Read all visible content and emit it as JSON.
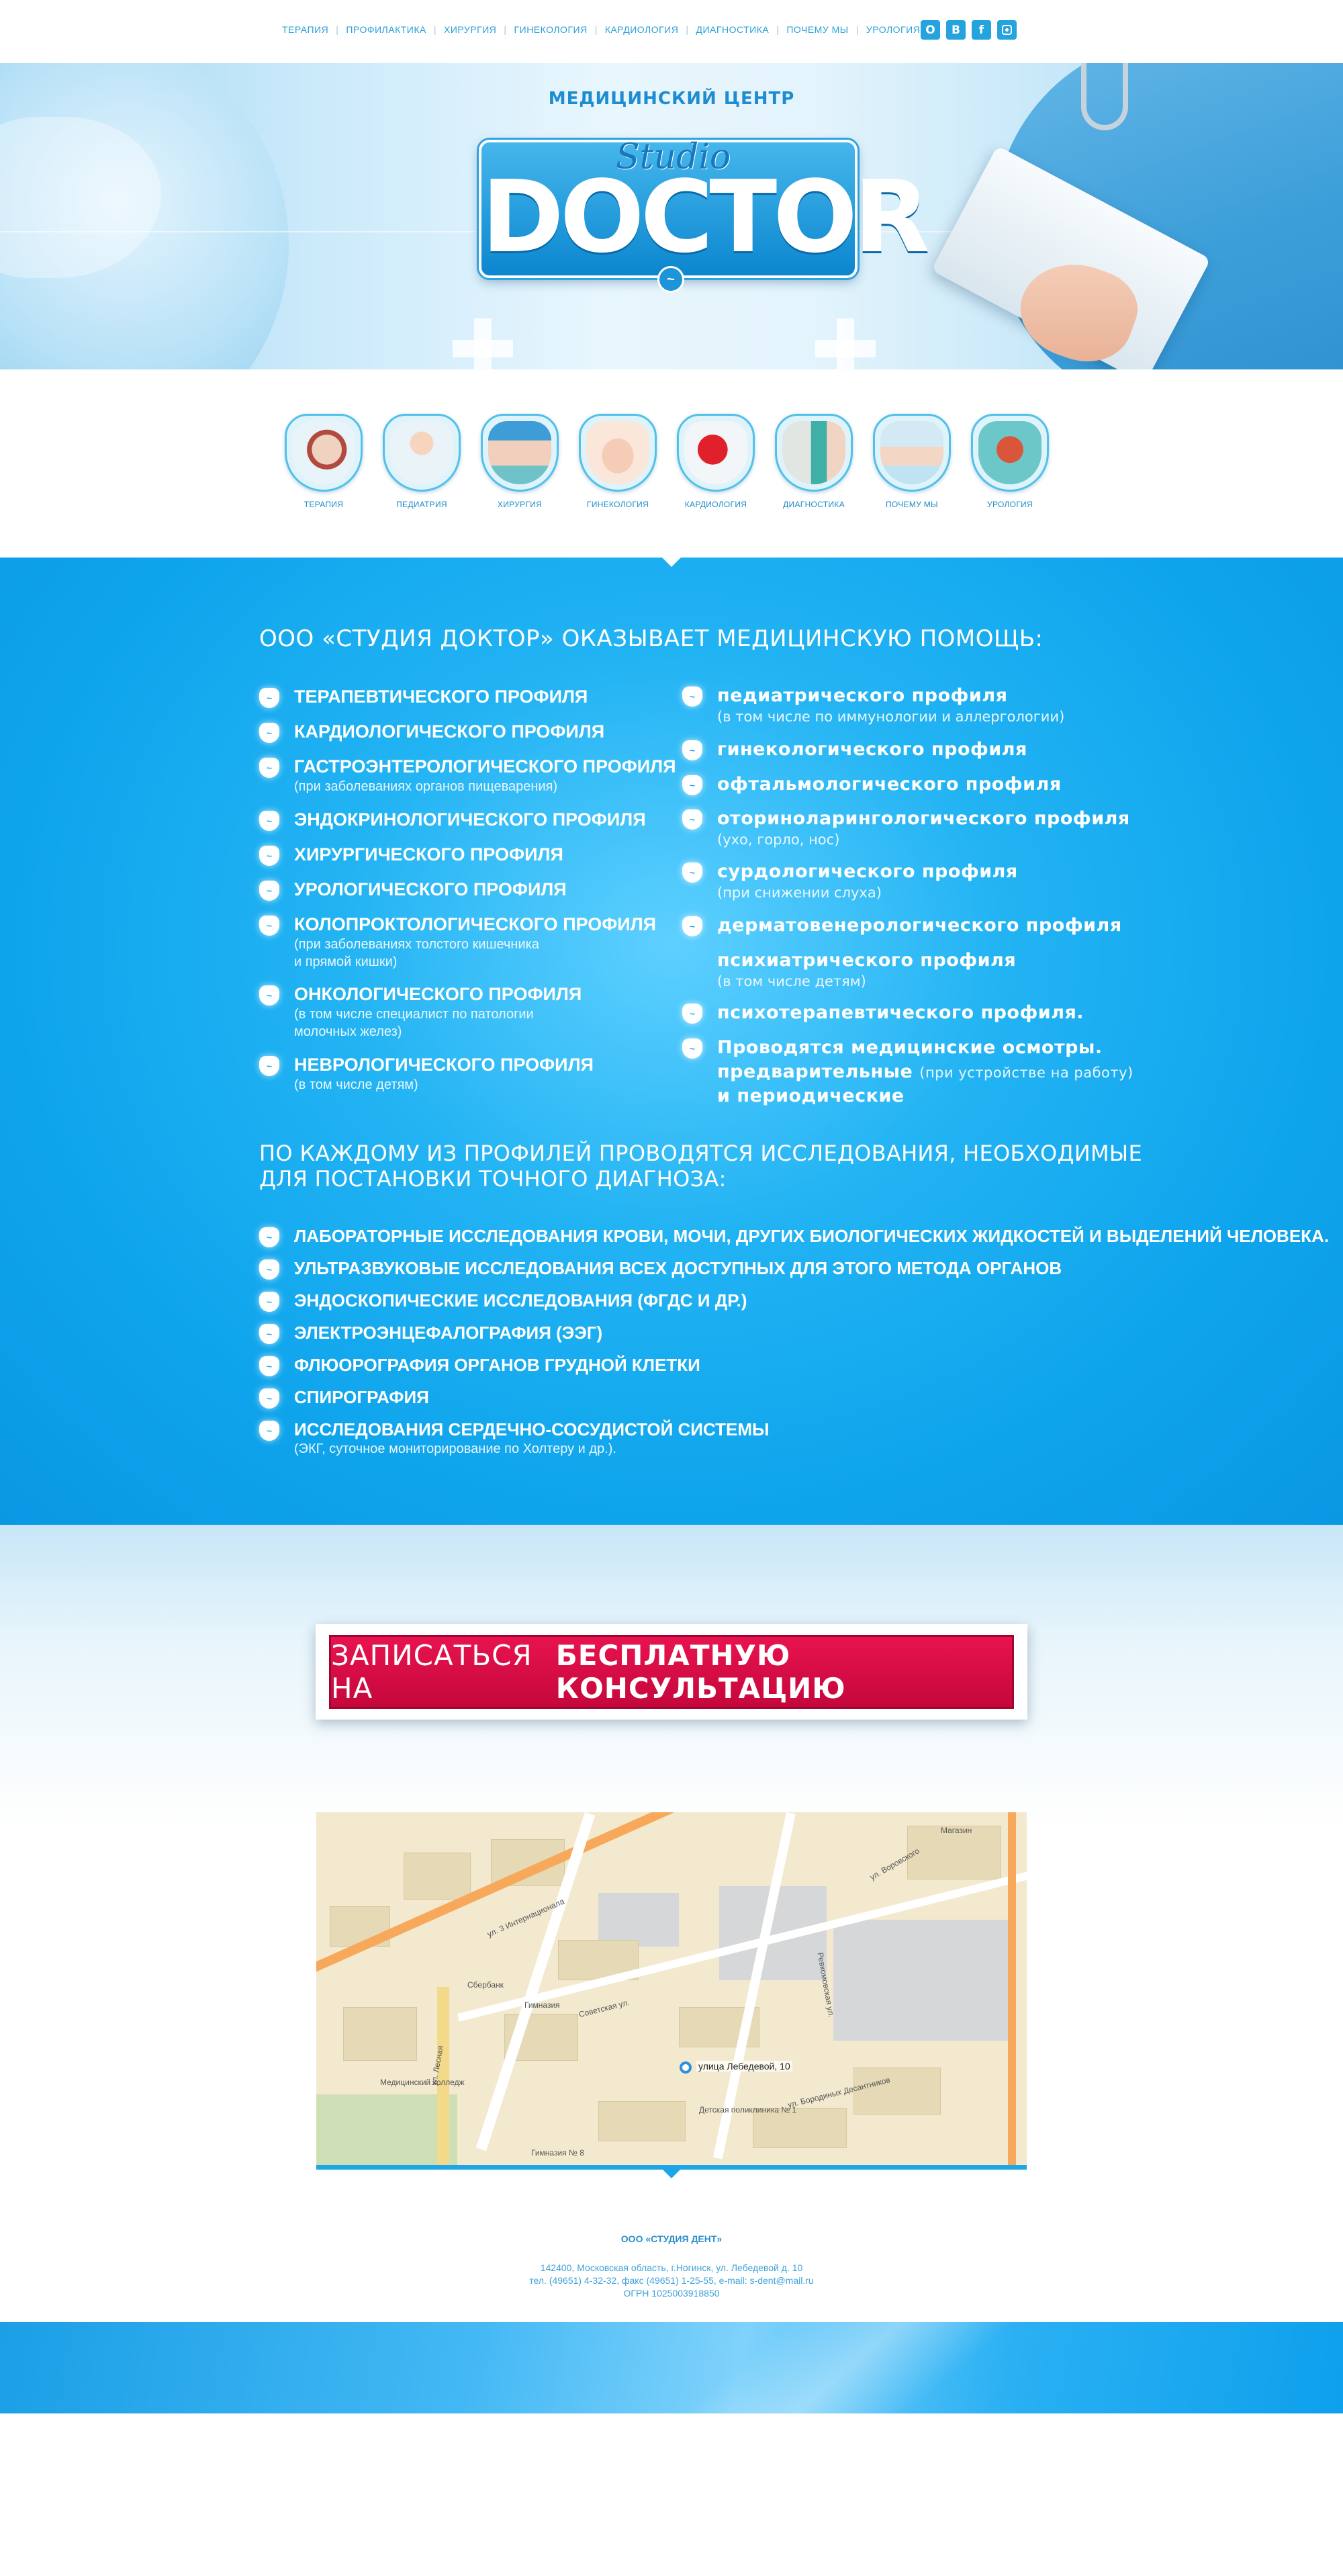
{
  "nav": {
    "links": [
      "ТЕРАПИЯ",
      "ПРОФИЛАКТИКА",
      "ХИРУРГИЯ",
      "ГИНЕКОЛОГИЯ",
      "КАРДИОЛОГИЯ",
      "ДИАГНОСТИКА",
      "ПОЧЕМУ МЫ",
      "УРОЛОГИЯ"
    ],
    "social": [
      "ok-icon",
      "vk-icon",
      "facebook-icon",
      "instagram-icon"
    ]
  },
  "hero": {
    "subtitle": "МЕДИЦИНСКИЙ ЦЕНТР",
    "logo_script": "Studio",
    "logo_main": "DOCTOR"
  },
  "categories": [
    {
      "label": "ТЕРАПИЯ",
      "icon": "stethoscope-icon"
    },
    {
      "label": "ПЕДИАТРИЯ",
      "icon": "baby-icon"
    },
    {
      "label": "ХИРУРГИЯ",
      "icon": "surgeon-icon"
    },
    {
      "label": "ГИНЕКОЛОГИЯ",
      "icon": "heart-hands-icon"
    },
    {
      "label": "КАРДИОЛОГИЯ",
      "icon": "heart-icon"
    },
    {
      "label": "ДИАГНОСТИКА",
      "icon": "lab-icon"
    },
    {
      "label": "ПОЧЕМУ МЫ",
      "icon": "doctor-icon"
    },
    {
      "label": "УРОЛОГИЯ",
      "icon": "kidney-icon"
    }
  ],
  "services": {
    "intro": "ООО «СТУДИЯ ДОКТОР» ОКАЗЫВАЕТ МЕДИЦИНСКУЮ ПОМОЩЬ:",
    "col1": [
      {
        "title": "ТЕРАПЕВТИЧЕСКОГО ПРОФИЛЯ",
        "note": ""
      },
      {
        "title": "КАРДИОЛОГИЧЕСКОГО ПРОФИЛЯ",
        "note": ""
      },
      {
        "title": "ГАСТРОЭНТЕРОЛОГИЧЕСКОГО ПРОФИЛЯ",
        "note": "(при заболеваниях органов пищеварения)"
      },
      {
        "title": "ЭНДОКРИНОЛОГИЧЕСКОГО ПРОФИЛЯ",
        "note": ""
      },
      {
        "title": "ХИРУРГИЧЕСКОГО ПРОФИЛЯ",
        "note": ""
      },
      {
        "title": "УРОЛОГИЧЕСКОГО ПРОФИЛЯ",
        "note": ""
      },
      {
        "title": "КОЛОПРОКТОЛОГИЧЕСКОГО ПРОФИЛЯ",
        "note": "(при заболеваниях толстого кишечника",
        "note2": "и прямой кишки)"
      },
      {
        "title": "ОНКОЛОГИЧЕСКОГО ПРОФИЛЯ",
        "note": "(в том числе специалист по патологии",
        "note2": "молочных желез)"
      },
      {
        "title": "НЕВРОЛОГИЧЕСКОГО ПРОФИЛЯ",
        "note": "(в том числе детям)"
      }
    ],
    "col2": [
      {
        "title": "педиатрического профиля",
        "note": "(в том числе по иммунологии и аллергологии)"
      },
      {
        "title": "гинекологического профиля",
        "note": ""
      },
      {
        "title": "офтальмологического профиля",
        "note": ""
      },
      {
        "title": "оториноларингологического профиля",
        "note": "(ухо, горло, нос)"
      },
      {
        "title": "сурдологического профиля",
        "note": "(при снижении слуха)"
      },
      {
        "title": "дерматовенерологического профиля",
        "note": ""
      },
      {
        "title": "психиатрического профиля",
        "note": "(в том числе детям)"
      },
      {
        "title": "психотерапевтического профиля.",
        "note": ""
      },
      {
        "title": "Проводятся медицинские осмотры.",
        "line2": "предварительные",
        "line2note": "(при устройстве на работу)",
        "line3": "и периодические"
      }
    ]
  },
  "research": {
    "title_line1": "ПО КАЖДОМУ ИЗ ПРОФИЛЕЙ ПРОВОДЯТСЯ ИССЛЕДОВАНИЯ, НЕОБХОДИМЫЕ",
    "title_line2": "ДЛЯ ПОСТАНОВКИ ТОЧНОГО ДИАГНОЗА:",
    "items": [
      {
        "title": "ЛАБОРАТОРНЫЕ ИССЛЕДОВАНИЯ КРОВИ, МОЧИ, ДРУГИХ БИОЛОГИЧЕСКИХ ЖИДКОСТЕЙ И ВЫДЕЛЕНИЙ ЧЕЛОВЕКА.",
        "note": ""
      },
      {
        "title": "УЛЬТРАЗВУКОВЫЕ ИССЛЕДОВАНИЯ ВСЕХ ДОСТУПНЫХ ДЛЯ ЭТОГО МЕТОДА ОРГАНОВ",
        "note": ""
      },
      {
        "title": "ЭНДОСКОПИЧЕСКИЕ ИССЛЕДОВАНИЯ (ФГДС И ДР.)",
        "note": ""
      },
      {
        "title": "ЭЛЕКТРОЭНЦЕФАЛОГРАФИЯ (ЭЭГ)",
        "note": ""
      },
      {
        "title": "ФЛЮОРОГРАФИЯ ОРГАНОВ ГРУДНОЙ КЛЕТКИ",
        "note": ""
      },
      {
        "title": "СПИРОГРАФИЯ",
        "note": ""
      },
      {
        "title": "ИССЛЕДОВАНИЯ СЕРДЕЧНО-СОСУДИСТОЙ СИСТЕМЫ",
        "note": "(ЭКГ, суточное мониторирование по Холтеру и др.)."
      }
    ]
  },
  "cta": {
    "light": "ЗАПИСАТЬСЯ НА",
    "bold": "БЕСПЛАТНУЮ КОНСУЛЬТАЦИЮ"
  },
  "map": {
    "pin_label": "улица Лебедевой, 10",
    "street1": "ул. 3 Интернационала",
    "street2": "ул. Лесная",
    "street3": "Советская ул.",
    "street4": "ул. Воровского",
    "street5": "ул. Бородиных Десантников",
    "street6": "Ревкомовская ул.",
    "place1": "Детская поликлиника № 1",
    "place2": "Гимназия № 8",
    "place3": "Гимназия",
    "place4": "Медицинский колледж",
    "place5": "Сбербанк",
    "place6": "Магазин"
  },
  "footer": {
    "company": "ООО «СТУДИЯ ДЕНТ»",
    "addr1": "142400, Московская область, г.Ногинск, ул. Лебедевой д. 10",
    "addr2": "тел. (49651) 4-32-32, факс (49651) 1-25-55, e-mail: s-dent@mail.ru",
    "addr3": "ОГРН 1025003918850"
  },
  "colors": {
    "accent": "#24a3de",
    "blue_section": "#0ea4ec",
    "cta": "#d60b45"
  }
}
